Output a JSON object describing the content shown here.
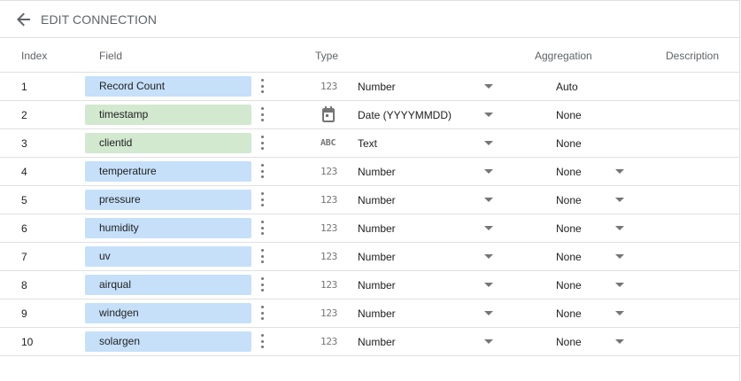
{
  "header": {
    "title": "EDIT CONNECTION",
    "back_icon": "arrow-left-icon"
  },
  "columns": {
    "index": "Index",
    "field": "Field",
    "type": "Type",
    "aggregation": "Aggregation",
    "description": "Description"
  },
  "colors": {
    "dimension_chip": "#c6e0fa",
    "time_chip": "#d2e8cf",
    "divider": "#e0e0e0"
  },
  "rows": [
    {
      "index": "1",
      "field": "Record Count",
      "chip": "dim",
      "type_icon": "123",
      "type": "Number",
      "aggregation": "Auto",
      "agg_dropdown": false
    },
    {
      "index": "2",
      "field": "timestamp",
      "chip": "time",
      "type_icon": "calendar",
      "type": "Date (YYYYMMDD)",
      "aggregation": "None",
      "agg_dropdown": false
    },
    {
      "index": "3",
      "field": "clientid",
      "chip": "time",
      "type_icon": "ABC",
      "type": "Text",
      "aggregation": "None",
      "agg_dropdown": false
    },
    {
      "index": "4",
      "field": "temperature",
      "chip": "dim",
      "type_icon": "123",
      "type": "Number",
      "aggregation": "None",
      "agg_dropdown": true
    },
    {
      "index": "5",
      "field": "pressure",
      "chip": "dim",
      "type_icon": "123",
      "type": "Number",
      "aggregation": "None",
      "agg_dropdown": true
    },
    {
      "index": "6",
      "field": "humidity",
      "chip": "dim",
      "type_icon": "123",
      "type": "Number",
      "aggregation": "None",
      "agg_dropdown": true
    },
    {
      "index": "7",
      "field": "uv",
      "chip": "dim",
      "type_icon": "123",
      "type": "Number",
      "aggregation": "None",
      "agg_dropdown": true
    },
    {
      "index": "8",
      "field": "airqual",
      "chip": "dim",
      "type_icon": "123",
      "type": "Number",
      "aggregation": "None",
      "agg_dropdown": true
    },
    {
      "index": "9",
      "field": "windgen",
      "chip": "dim",
      "type_icon": "123",
      "type": "Number",
      "aggregation": "None",
      "agg_dropdown": true
    },
    {
      "index": "10",
      "field": "solargen",
      "chip": "dim",
      "type_icon": "123",
      "type": "Number",
      "aggregation": "None",
      "agg_dropdown": true
    }
  ]
}
